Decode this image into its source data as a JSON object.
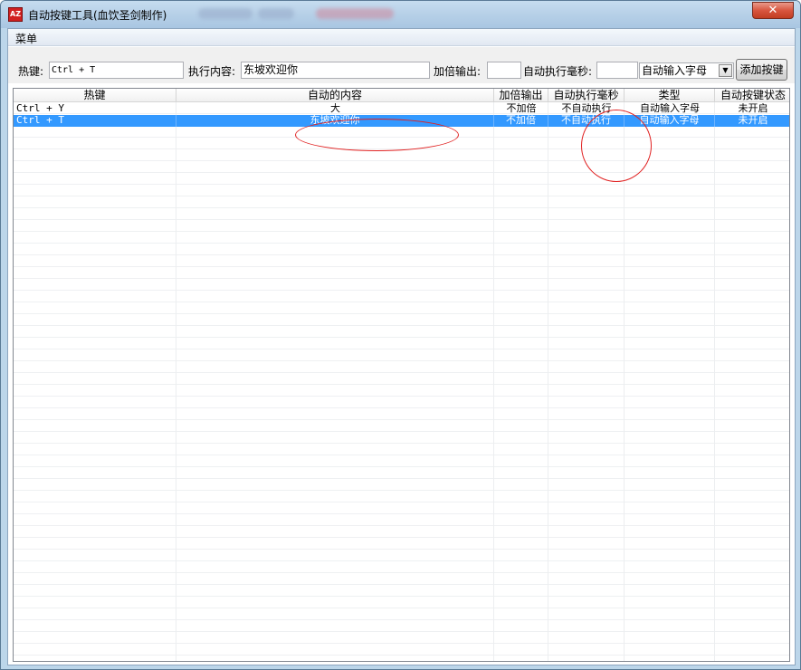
{
  "window": {
    "title": "自动按键工具(血饮圣剑制作)",
    "close_glyph": "✕"
  },
  "menu": {
    "items": [
      "菜单"
    ]
  },
  "toolbar": {
    "hotkey_label": "热键:",
    "hotkey_value": "Ctrl + T",
    "content_label": "执行内容:",
    "content_value": "东坡欢迎你",
    "multiplier_label": "加倍输出:",
    "multiplier_value": "",
    "interval_label": "自动执行毫秒:",
    "interval_value": "",
    "type_selected": "自动输入字母",
    "add_button": "添加按键"
  },
  "table": {
    "columns": [
      "热键",
      "自动的内容",
      "加倍输出",
      "自动执行毫秒",
      "类型",
      "自动按键状态"
    ],
    "rows": [
      [
        "Ctrl + Y",
        "大",
        "不加倍",
        "不自动执行",
        "自动输入字母",
        "未开启"
      ],
      [
        "Ctrl + T",
        "东坡欢迎你",
        "不加倍",
        "不自动执行",
        "自动输入字母",
        "未开启"
      ]
    ],
    "selected_row": 1
  },
  "colors": {
    "selection": "#3399ff",
    "annotation": "#e02020",
    "title_bar": "#b8d1e8"
  }
}
